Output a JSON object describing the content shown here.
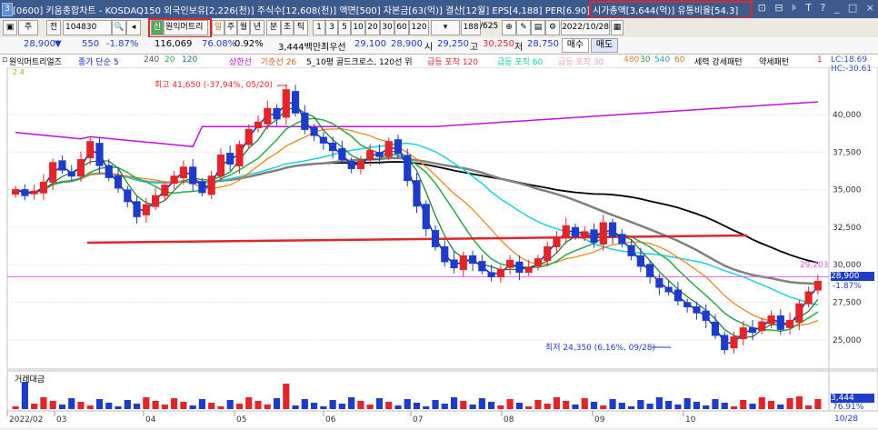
{
  "titlebar": {
    "badge": "3",
    "title": "[0600] 키움종합차트 - KOSDAQ150 외국인보유[2,226(천)] 주식수[12,608(천)] 액면[500] 자본금[63(억)] 결산[12월] EPS[4,188] PER[6.90]",
    "market_cap": "시가총액[3,644(억)] 유통비율[54.3]",
    "window_buttons": [
      "⊡",
      "⊟",
      "⊧",
      "T",
      "?",
      "_",
      "□",
      "×"
    ]
  },
  "toolbar": {
    "combo_type": "주",
    "combo_all": "전",
    "stock_code": "104830",
    "search_icon": "search-icon",
    "stock_name_tag": "신",
    "stock_name": "원익머트리",
    "periods": [
      "일",
      "주",
      "월",
      "년",
      "분",
      "초",
      "틱"
    ],
    "minute_steps": [
      "1",
      "3",
      "5",
      "10",
      "20",
      "30",
      "60",
      "120"
    ],
    "count": "188",
    "count_total": "/625",
    "date": "2022/10/28"
  },
  "infobar": {
    "price": "28,900",
    "change": "550",
    "change_pct": "-1.87%",
    "volume": "116,069",
    "vol_ratio": "76.08%",
    "turnover": "0.92%",
    "amount": "3,444백만",
    "min_label": "최우선",
    "best_ask": "29,100",
    "best_bid": "28,900",
    "open_label": "시",
    "open": "29,250",
    "high_label": "고",
    "high": "30,250",
    "low_label": "저",
    "low": "28,750",
    "buy": "매수",
    "sell": "매도"
  },
  "legend": {
    "name": "원익머트리얼즈",
    "ma_title": "종가 단순 5",
    "ma_240": "240",
    "ma_20": "20",
    "ma_120": "120",
    "line_1": "상한선",
    "line_2": "기준선 26",
    "golden": "5_10평 골드크로스, 120선 위",
    "spike_120": "급등 포착 120",
    "spike_60": "급등 포착 60",
    "spike_30": "급등 포착 30",
    "spike_vals": [
      "480",
      "30",
      "540",
      "60"
    ],
    "strong": "세력 강세패턴",
    "weak": "약세패턴",
    "one": "1",
    "lc": "LC:18.69",
    "hc": "HC:-30.61",
    "sub": "2 4"
  },
  "chart_data": {
    "type": "candlestick",
    "y_ticks": [
      40000,
      37500,
      35000,
      32500,
      30000,
      27500,
      25000
    ],
    "y_tick_labels": [
      "40,000",
      "37,500",
      "35,000",
      "32,500",
      "30,000",
      "27,500",
      "25,000"
    ],
    "ylim": [
      23300,
      42900
    ],
    "x_labels": [
      "2022/02",
      "03",
      "04",
      "05",
      "06",
      "07",
      "08",
      "09",
      "10"
    ],
    "high_note": "최고 41,650 (-37,94%, 05/20)",
    "low_note": "최저 24,350 (6.16%, 09/28)",
    "ref_line_label": "29,203",
    "ref_line_value": 29203,
    "current_price_label": "28,900",
    "current_pct_label": "-1.87%",
    "support_level": 31950,
    "closes": [
      35000,
      34600,
      34900,
      35500,
      36800,
      36300,
      35900,
      37000,
      38200,
      36600,
      35800,
      35100,
      34200,
      33200,
      34000,
      34600,
      35300,
      35900,
      36500,
      35400,
      34800,
      35900,
      37300,
      36700,
      38000,
      39000,
      39500,
      40400,
      39700,
      41650,
      40100,
      39000,
      38600,
      38100,
      37600,
      37000,
      36400,
      36900,
      37600,
      37200,
      38200,
      37400,
      35600,
      33900,
      32400,
      31200,
      30200,
      29800,
      30600,
      30100,
      29600,
      29200,
      29700,
      30300,
      29500,
      29800,
      30400,
      31200,
      31800,
      32600,
      31900,
      32200,
      31500,
      32800,
      31900,
      31400,
      30600,
      29900,
      29200,
      28500,
      28200,
      27600,
      27200,
      26800,
      26300,
      25300,
      24350,
      25200,
      25800,
      25500,
      26200,
      26600,
      25700,
      26300,
      27400,
      28200,
      28900
    ],
    "volume_label": "거래대금",
    "volume_value_label": "3,444",
    "volume_pct_label": "76.91%",
    "date_label": "10/28"
  },
  "colors": {
    "candle_up": "#e0262b",
    "candle_down": "#1e3cc8",
    "ma5": "#0a2cc8",
    "ma20": "#2aa84a",
    "ma60": "#ef7d10",
    "ma120": "#1ad0e0",
    "ma240": "#000000",
    "envelope": "#c010e0",
    "support": "#e0262b",
    "ref": "#e060e0"
  }
}
